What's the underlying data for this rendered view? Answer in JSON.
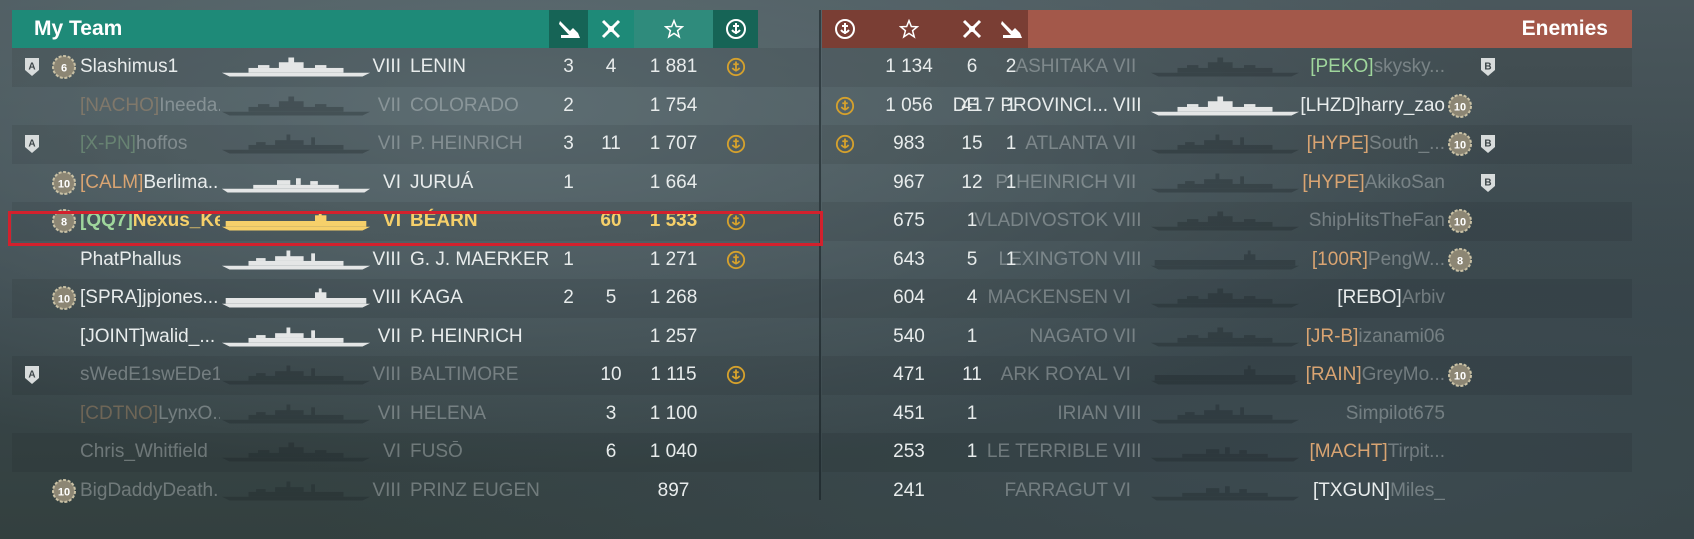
{
  "colors": {
    "team_header": "#1e8a78",
    "team_header_dark": "#166456",
    "enemy_header": "#a3584a",
    "enemy_header_dark": "#7a3e34",
    "highlight_ship": "#f6d06a",
    "selection_border": "#d3212d"
  },
  "team": {
    "title": "My Team",
    "header_icons": [
      "plane-kill-icon",
      "frag-icon",
      "star-icon",
      "fleet-anchor-icon"
    ],
    "rows": [
      {
        "rank_badge": "A",
        "level_badge": "6",
        "clan": "",
        "name": "Slashimus1",
        "tier": "VIII",
        "ship": "LENIN",
        "planes": "3",
        "kills": "4",
        "score": "1 881",
        "anchor": true,
        "dead": false,
        "highlight": false,
        "ship_class": "bb"
      },
      {
        "rank_badge": "",
        "level_badge": "",
        "clan": "[NACHO]",
        "name": "Ineeda...",
        "tier": "VII",
        "ship": "COLORADO",
        "planes": "2",
        "kills": "",
        "score": "1 754",
        "anchor": false,
        "dead": true,
        "highlight": false,
        "ship_class": "bb"
      },
      {
        "rank_badge": "A",
        "level_badge": "",
        "clan": "[X-PN]",
        "name": "hoffos",
        "tier": "VII",
        "ship": "P. HEINRICH",
        "planes": "3",
        "kills": "11",
        "score": "1 707",
        "anchor": true,
        "dead": true,
        "highlight": false,
        "ship_class": "ca",
        "clan_style": "green"
      },
      {
        "rank_badge": "",
        "level_badge": "10",
        "clan": "[CALM]",
        "name": "Berlima...",
        "tier": "VI",
        "ship": "JURUÁ",
        "planes": "1",
        "kills": "",
        "score": "1 664",
        "anchor": false,
        "dead": false,
        "highlight": false,
        "ship_class": "dd"
      },
      {
        "rank_badge": "",
        "level_badge": "8",
        "clan": "[QQ7]",
        "name": "Nexus_Ke...",
        "tier": "VI",
        "ship": "BÉARN",
        "planes": "",
        "kills": "60",
        "score": "1 533",
        "anchor": true,
        "dead": false,
        "highlight": true,
        "ship_class": "cv",
        "clan_style": "green"
      },
      {
        "rank_badge": "",
        "level_badge": "",
        "clan": "",
        "name": "PhatPhallus",
        "tier": "VIII",
        "ship": "G. J. MAERKER",
        "planes": "1",
        "kills": "",
        "score": "1 271",
        "anchor": true,
        "dead": false,
        "highlight": false,
        "ship_class": "ca"
      },
      {
        "rank_badge": "",
        "level_badge": "10",
        "clan": "[SPRA]",
        "name": "jpjones...",
        "tier": "VIII",
        "ship": "KAGA",
        "planes": "2",
        "kills": "5",
        "score": "1 268",
        "anchor": false,
        "dead": false,
        "highlight": false,
        "ship_class": "cv",
        "clan_style": "white"
      },
      {
        "rank_badge": "",
        "level_badge": "",
        "clan": "[JOINT]",
        "name": "walid_...",
        "tier": "VII",
        "ship": "P. HEINRICH",
        "planes": "",
        "kills": "",
        "score": "1 257",
        "anchor": false,
        "dead": false,
        "highlight": false,
        "ship_class": "ca",
        "clan_style": "white"
      },
      {
        "rank_badge": "A",
        "level_badge": "",
        "clan": "",
        "name": "sWedE1swEDe1",
        "tier": "VIII",
        "ship": "BALTIMORE",
        "planes": "",
        "kills": "10",
        "score": "1 115",
        "anchor": true,
        "dead": true,
        "highlight": false,
        "ship_class": "ca"
      },
      {
        "rank_badge": "",
        "level_badge": "",
        "clan": "[CDTNO]",
        "name": "LynxO...",
        "tier": "VII",
        "ship": "HELENA",
        "planes": "",
        "kills": "3",
        "score": "1 100",
        "anchor": false,
        "dead": true,
        "highlight": false,
        "ship_class": "ca"
      },
      {
        "rank_badge": "",
        "level_badge": "",
        "clan": "",
        "name": "Chris_Whitfield",
        "tier": "VI",
        "ship": "FUSŌ",
        "planes": "",
        "kills": "6",
        "score": "1 040",
        "anchor": false,
        "dead": true,
        "highlight": false,
        "ship_class": "bb"
      },
      {
        "rank_badge": "",
        "level_badge": "10",
        "clan": "",
        "name": "BigDaddyDeath...",
        "tier": "VIII",
        "ship": "PRINZ EUGEN",
        "planes": "",
        "kills": "",
        "score": "897",
        "anchor": false,
        "dead": true,
        "highlight": false,
        "ship_class": "ca"
      }
    ]
  },
  "enemies": {
    "title": "Enemies",
    "header_icons": [
      "fleet-anchor-icon",
      "star-icon",
      "frag-icon",
      "plane-kill-icon"
    ],
    "rows": [
      {
        "anchor": false,
        "score": "1 134",
        "kills": "6",
        "planes": "2",
        "ship": "ASHITAKA",
        "tier": "VII",
        "clan": "[PEKO]",
        "name": "skysky...",
        "level_badge": "",
        "rank_badge": "B",
        "dead": true,
        "clan_style": "green",
        "ship_class": "bb"
      },
      {
        "anchor": true,
        "score": "1 056",
        "kills": "41",
        "planes": "1",
        "ship": "DE 7 PROVINCI...",
        "tier": "VIII",
        "clan": "[LHZD]",
        "name": "harry_zao",
        "level_badge": "10",
        "rank_badge": "",
        "dead": false,
        "clan_style": "white",
        "ship_class": "bb"
      },
      {
        "anchor": true,
        "score": "983",
        "kills": "15",
        "planes": "1",
        "ship": "ATLANTA",
        "tier": "VII",
        "clan": "[HYPE]",
        "name": "South_...",
        "level_badge": "10",
        "rank_badge": "B",
        "dead": true,
        "ship_class": "ca"
      },
      {
        "anchor": false,
        "score": "967",
        "kills": "12",
        "planes": "1",
        "ship": "P. HEINRICH",
        "tier": "VII",
        "clan": "[HYPE]",
        "name": "AkikoSan",
        "level_badge": "",
        "rank_badge": "B",
        "dead": true,
        "ship_class": "ca"
      },
      {
        "anchor": false,
        "score": "675",
        "kills": "1",
        "planes": "",
        "ship": "VLADIVOSTOK",
        "tier": "VIII",
        "clan": "",
        "name": "ShipHitsTheFan",
        "level_badge": "10",
        "rank_badge": "",
        "dead": true,
        "ship_class": "bb"
      },
      {
        "anchor": false,
        "score": "643",
        "kills": "5",
        "planes": "1",
        "ship": "LEXINGTON",
        "tier": "VIII",
        "clan": "[100R]",
        "name": "PengW...",
        "level_badge": "8",
        "rank_badge": "",
        "dead": true,
        "ship_class": "cv"
      },
      {
        "anchor": false,
        "score": "604",
        "kills": "4",
        "planes": "",
        "ship": "MACKENSEN",
        "tier": "VI",
        "clan": "[REBO]",
        "name": "Arbiv",
        "level_badge": "",
        "rank_badge": "",
        "dead": true,
        "clan_style": "white",
        "ship_class": "bb"
      },
      {
        "anchor": false,
        "score": "540",
        "kills": "1",
        "planes": "",
        "ship": "NAGATO",
        "tier": "VII",
        "clan": "[JR-B]",
        "name": "izanami06",
        "level_badge": "",
        "rank_badge": "",
        "dead": true,
        "ship_class": "bb"
      },
      {
        "anchor": false,
        "score": "471",
        "kills": "11",
        "planes": "",
        "ship": "ARK ROYAL",
        "tier": "VI",
        "clan": "[RAIN]",
        "name": "GreyMo...",
        "level_badge": "10",
        "rank_badge": "",
        "dead": true,
        "ship_class": "cv"
      },
      {
        "anchor": false,
        "score": "451",
        "kills": "1",
        "planes": "",
        "ship": "IRIAN",
        "tier": "VIII",
        "clan": "",
        "name": "Simpilot675",
        "level_badge": "",
        "rank_badge": "",
        "dead": true,
        "ship_class": "ca"
      },
      {
        "anchor": false,
        "score": "253",
        "kills": "1",
        "planes": "",
        "ship": "LE TERRIBLE",
        "tier": "VIII",
        "clan": "[MACHT]",
        "name": "Tirpit...",
        "level_badge": "",
        "rank_badge": "",
        "dead": true,
        "ship_class": "dd"
      },
      {
        "anchor": false,
        "score": "241",
        "kills": "",
        "planes": "",
        "ship": "FARRAGUT",
        "tier": "VI",
        "clan": "[TXGUN]",
        "name": "Miles_",
        "level_badge": "",
        "rank_badge": "",
        "dead": true,
        "clan_style": "white",
        "ship_class": "dd"
      }
    ]
  }
}
